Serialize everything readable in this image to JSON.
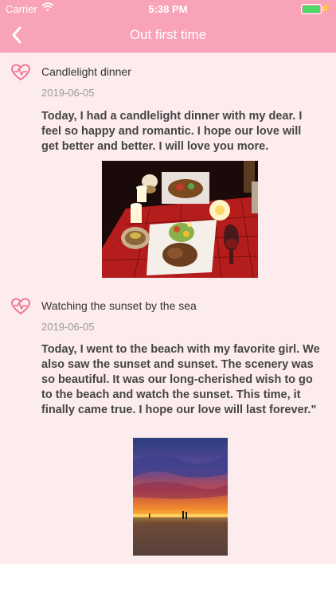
{
  "status_bar": {
    "carrier": "Carrier",
    "time": "5:38 PM"
  },
  "nav": {
    "title": "Out first time",
    "back_icon": "chevron-left-icon"
  },
  "entries": [
    {
      "title": "Candlelight dinner",
      "date": "2019-06-05",
      "text": "Today, I had a candlelight dinner with my dear. I feel so happy and romantic. I hope our love will get better and better. I will love you more.",
      "icon": "heart-pulse-icon"
    },
    {
      "title": "Watching the sunset by the sea",
      "date": "2019-06-05",
      "text": "Today, I went to the beach with my favorite girl. We also saw the sunset and sunset. The scenery was so beautiful. It was our long-cherished wish to go to the beach and watch the sunset. This time, it finally came true. I hope our love will last forever.\"",
      "icon": "heart-pulse-icon"
    }
  ],
  "colors": {
    "header": "#f9a3b8",
    "content_bg": "#fdecee",
    "heart": "#ee6b8a"
  }
}
